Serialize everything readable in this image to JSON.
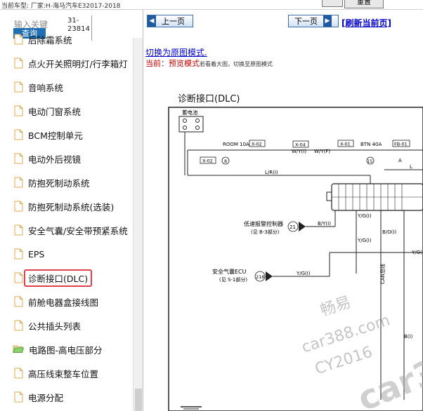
{
  "topbar": {
    "car_model": "当前车型:  厂家:H-海马汽车E32017-2018",
    "top_button": "重置"
  },
  "search": {
    "label": "输入关键",
    "button": "查询",
    "code_line1": "31-",
    "code_line2": "23814"
  },
  "tree": {
    "items": [
      {
        "label": "后除霜系统",
        "type": "doc"
      },
      {
        "label": "点火开关照明灯/行李箱灯",
        "type": "doc"
      },
      {
        "label": "音响系统",
        "type": "doc"
      },
      {
        "label": "电动门窗系统",
        "type": "doc"
      },
      {
        "label": "BCM控制单元",
        "type": "doc"
      },
      {
        "label": "电动外后视镜",
        "type": "doc"
      },
      {
        "label": "防抱死制动系统",
        "type": "doc"
      },
      {
        "label": "防抱死制动系统(选装)",
        "type": "doc"
      },
      {
        "label": "安全气囊/安全带预紧系统",
        "type": "doc"
      },
      {
        "label": "EPS",
        "type": "doc"
      },
      {
        "label": "诊断接口(DLC)",
        "type": "doc",
        "selected": true
      },
      {
        "label": "前舱电器盒接线图",
        "type": "doc"
      },
      {
        "label": "公共插头列表",
        "type": "doc"
      },
      {
        "label": "电路图-高电压部分",
        "type": "folder"
      },
      {
        "label": "高压线束整车位置",
        "type": "doc"
      },
      {
        "label": "电源分配",
        "type": "doc"
      }
    ]
  },
  "nav": {
    "prev": "上一页",
    "next": "下一页",
    "refresh": "[刷新当前页]"
  },
  "mode": {
    "switch_link": "切换为原图模式.",
    "current_prefix": "当前：",
    "current_mode": "预览模式",
    "hint": "若看着大图，切换至原图模式"
  },
  "diagram": {
    "title": "诊断接口(DLC)",
    "battery": "蓄电池",
    "labels": {
      "room": "ROOM 10A",
      "x02a": "X-02",
      "x04": "X-04",
      "x01": "X-01",
      "btn": "BTN 40A",
      "fb01": "FB-01",
      "x02b": "X-02",
      "n8": "8",
      "n15": "15",
      "wy1": "W/Y(I)",
      "wy2": "W/Y(F)",
      "a": "A",
      "lr": "L/R(I)",
      "l": "L",
      "ctrl1": "低速报警控制器",
      "ctrl1sub": "(见 B-3部分)",
      "n21": "21",
      "by": "B/Y(I)",
      "ctrl2": "安全气囊ECU",
      "ctrl2sub": "(见 S-1部分)",
      "n218": "218",
      "yg1": "Y/G(I)",
      "yg2": "Y/G(I)",
      "yg3": "Y/G(I)",
      "bo": "B/O(I)",
      "ygr": "Y/G(",
      "bl": "B(I)",
      "canbus": "CAN总线"
    }
  },
  "watermark": {
    "cn": "畅易",
    "site": "car388.com",
    "code": "CY2016",
    "brand": "car388"
  }
}
